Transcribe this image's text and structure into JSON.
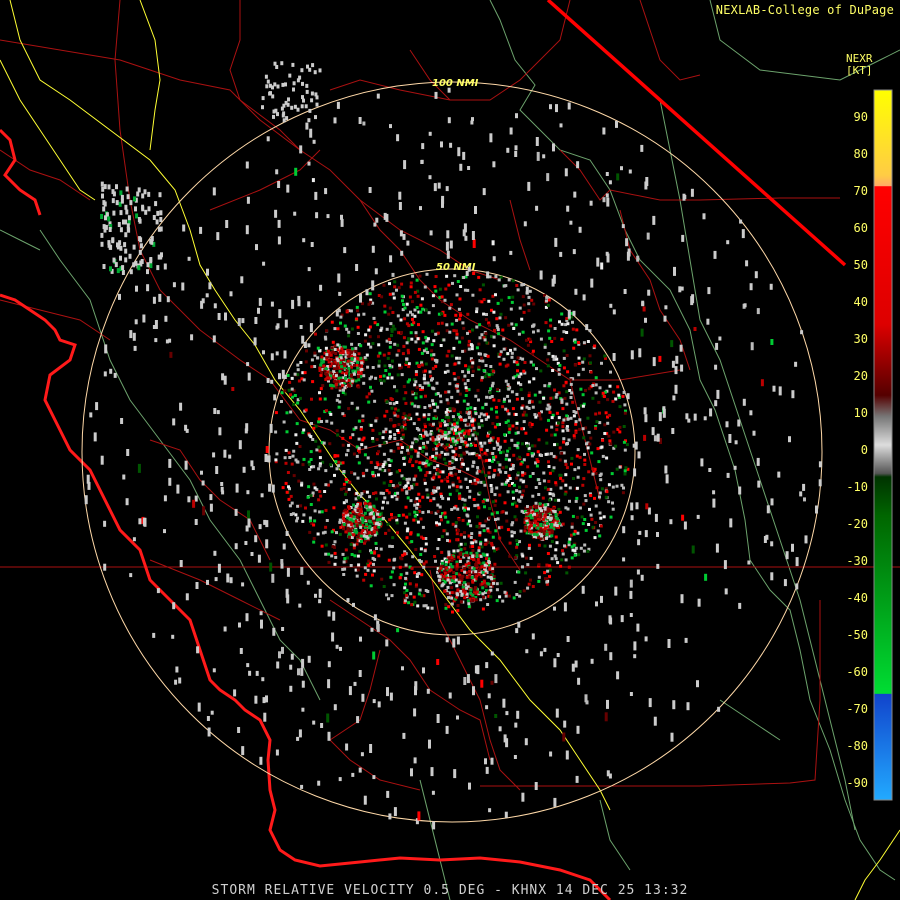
{
  "credit": "NEXLAB-College of DuPage",
  "legend": {
    "title_line1": "NEXR",
    "units": "[KT]",
    "ticks": [
      "90",
      "80",
      "70",
      "60",
      "50",
      "40",
      "30",
      "20",
      "10",
      "0",
      "-10",
      "-20",
      "-30",
      "-40",
      "-50",
      "-60",
      "-70",
      "-80",
      "-90"
    ],
    "colors": {
      "top_yellow": "#ffff00",
      "orange": "#ffaa55",
      "red": "#ff0000",
      "dark_red": "#660000",
      "gray": "#bbbbbb",
      "dark_green": "#005500",
      "green": "#00cc33",
      "blue": "#1155dd",
      "light_blue": "#22aaff"
    }
  },
  "rings": {
    "inner_label": "50 NMI",
    "outer_label": "100 NMI"
  },
  "footer": "STORM RELATIVE VELOCITY 0.5 DEG - KHNX 14 DEC 25 13:32",
  "map_colors": {
    "county": "#bb1111",
    "highway": "#ffff33",
    "coast": "#ff1111",
    "terrain": "#99dd99",
    "ring": "#ffddaa"
  }
}
